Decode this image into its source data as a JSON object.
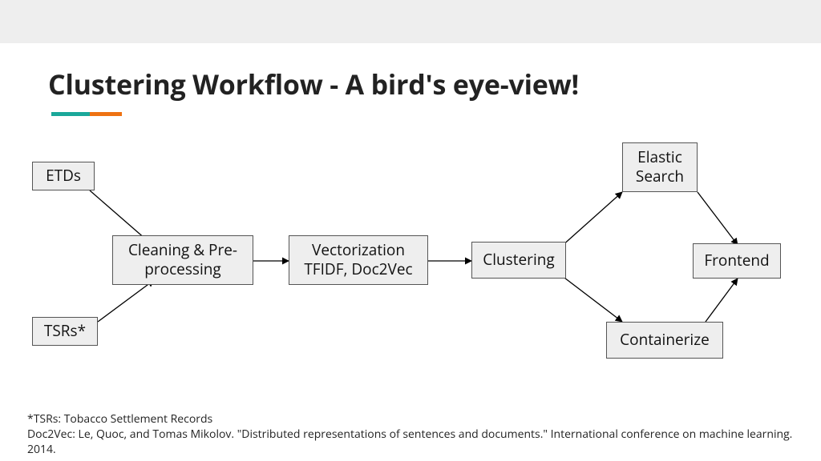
{
  "title": "Clustering Workflow - A bird's eye-view!",
  "boxes": {
    "etds": "ETDs",
    "tsrs": "TSRs*",
    "cleaning": "Cleaning & Pre-processing",
    "vectorization": "Vectorization TFIDF, Doc2Vec",
    "clustering": "Clustering",
    "elastic": "Elastic Search",
    "containerize": "Containerize",
    "frontend": "Frontend"
  },
  "footnotes": {
    "l1": "*TSRs: Tobacco Settlement Records",
    "l2": "Doc2Vec: Le, Quoc, and Tomas Mikolov. \"Distributed representations of sentences and documents.\" International conference on machine learning. 2014."
  },
  "chart_data": {
    "type": "flowchart",
    "nodes": [
      {
        "id": "etds",
        "label": "ETDs"
      },
      {
        "id": "tsrs",
        "label": "TSRs*"
      },
      {
        "id": "cleaning",
        "label": "Cleaning & Pre-processing"
      },
      {
        "id": "vectorization",
        "label": "Vectorization TFIDF, Doc2Vec"
      },
      {
        "id": "clustering",
        "label": "Clustering"
      },
      {
        "id": "elastic",
        "label": "Elastic Search"
      },
      {
        "id": "containerize",
        "label": "Containerize"
      },
      {
        "id": "frontend",
        "label": "Frontend"
      }
    ],
    "edges": [
      [
        "etds",
        "cleaning"
      ],
      [
        "tsrs",
        "cleaning"
      ],
      [
        "cleaning",
        "vectorization"
      ],
      [
        "vectorization",
        "clustering"
      ],
      [
        "clustering",
        "elastic"
      ],
      [
        "clustering",
        "containerize"
      ],
      [
        "elastic",
        "frontend"
      ],
      [
        "containerize",
        "frontend"
      ]
    ]
  }
}
